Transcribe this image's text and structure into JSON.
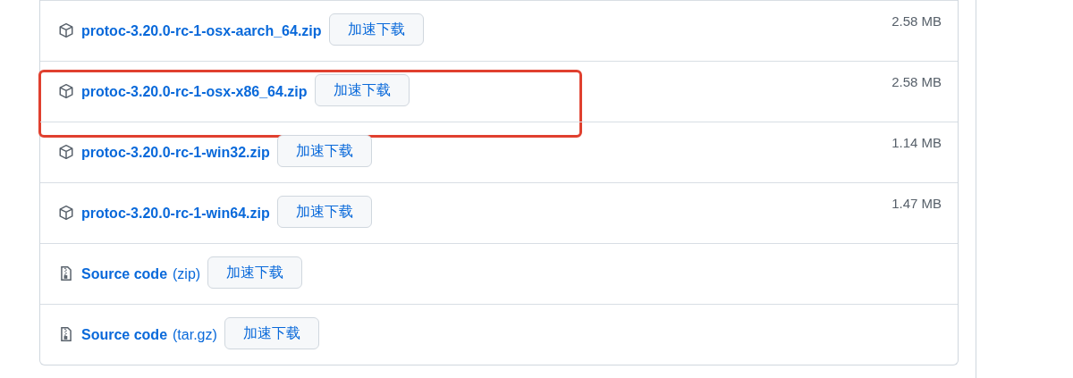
{
  "assets": [
    {
      "kind": "package",
      "name": "protoc-3.20.0-rc-1-osx-aarch_64.zip",
      "button": "加速下载",
      "size": "2.58 MB",
      "highlighted": false
    },
    {
      "kind": "package",
      "name": "protoc-3.20.0-rc-1-osx-x86_64.zip",
      "button": "加速下载",
      "size": "2.58 MB",
      "highlighted": true
    },
    {
      "kind": "package",
      "name": "protoc-3.20.0-rc-1-win32.zip",
      "button": "加速下载",
      "size": "1.14 MB",
      "highlighted": false
    },
    {
      "kind": "package",
      "name": "protoc-3.20.0-rc-1-win64.zip",
      "button": "加速下载",
      "size": "1.47 MB",
      "highlighted": false
    },
    {
      "kind": "source",
      "name": "Source code",
      "format": "(zip)",
      "button": "加速下载",
      "highlighted": false
    },
    {
      "kind": "source",
      "name": "Source code",
      "format": "(tar.gz)",
      "button": "加速下载",
      "highlighted": false
    }
  ]
}
